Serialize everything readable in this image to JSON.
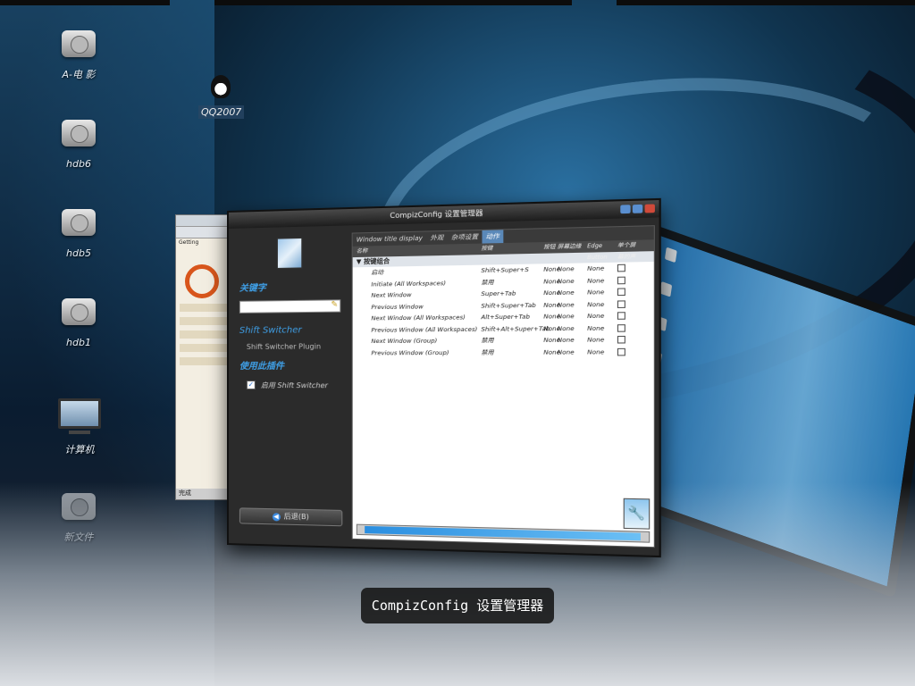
{
  "desktop": {
    "icons": [
      {
        "label": "A-电 影"
      },
      {
        "label": "hdb6"
      },
      {
        "label": "hdb5"
      },
      {
        "label": "hdb1"
      }
    ],
    "qq_label": "QQ2007",
    "computer_label": "计算机",
    "newfolder_label": "新文件"
  },
  "bg_window": {
    "tab_label": "Getting",
    "status": "完成"
  },
  "window": {
    "title": "CompizConfig 设置管理器",
    "sidebar": {
      "filter_label": "关键字",
      "filter_value": "",
      "plugin_name": "Shift Switcher",
      "plugin_desc": "Shift Switcher Plugin",
      "use_plugin_label": "使用此插件",
      "enable_label": "启用 Shift Switcher",
      "back_label": "后退(B)"
    },
    "tabs": [
      {
        "label": "Window title display"
      },
      {
        "label": "外观"
      },
      {
        "label": "杂项设置"
      },
      {
        "label": "动作"
      }
    ],
    "columns": {
      "name": "名称",
      "key": "按键",
      "s1": "按钮",
      "s2": "屏幕边缘",
      "s3": "Edge Button",
      "s4": "单个屏幕的声音"
    },
    "group": "按键组合",
    "rows": [
      {
        "name": "启动",
        "key": "Shift+Super+S",
        "b": "None",
        "e": "None",
        "ev": "None"
      },
      {
        "name": "Initiate (All Workspaces)",
        "key": "禁用",
        "b": "None",
        "e": "None",
        "ev": "None"
      },
      {
        "name": "Next Window",
        "key": "Super+Tab",
        "b": "None",
        "e": "None",
        "ev": "None"
      },
      {
        "name": "Previous Window",
        "key": "Shift+Super+Tab",
        "b": "None",
        "e": "None",
        "ev": "None"
      },
      {
        "name": "Next Window (All Workspaces)",
        "key": "Alt+Super+Tab",
        "b": "None",
        "e": "None",
        "ev": "None"
      },
      {
        "name": "Previous Window (All Workspaces)",
        "key": "Shift+Alt+Super+Tab",
        "b": "None",
        "e": "None",
        "ev": "None"
      },
      {
        "name": "Next Window (Group)",
        "key": "禁用",
        "b": "None",
        "e": "None",
        "ev": "None"
      },
      {
        "name": "Previous Window (Group)",
        "key": "禁用",
        "b": "None",
        "e": "None",
        "ev": "None"
      }
    ]
  },
  "switcher_caption": "CompizConfig 设置管理器",
  "colors": {
    "accent": "#3fa0e8",
    "scroll": "#2a8ee0"
  }
}
